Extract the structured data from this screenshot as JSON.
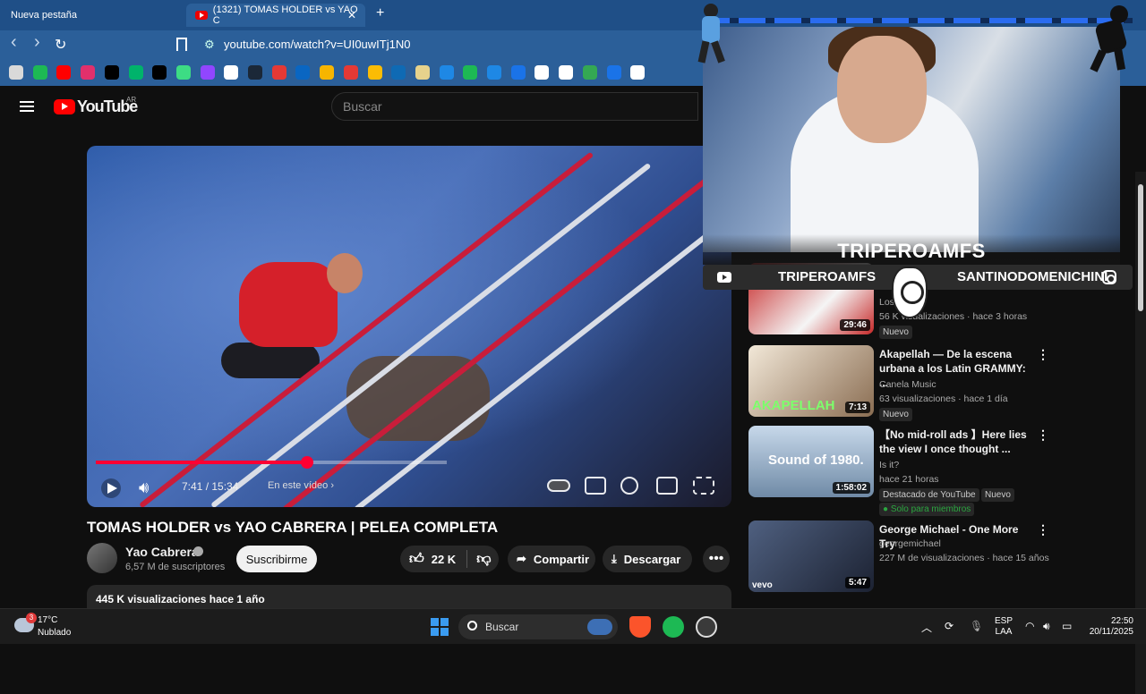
{
  "browser": {
    "tabs": [
      {
        "label": "Nueva pestaña"
      },
      {
        "label": "(1321) TOMAS HOLDER vs YAO C"
      }
    ],
    "close_glyph": "✕",
    "new_tab_glyph": "+",
    "url": "youtube.com/watch?v=UI0uwITj1N0",
    "nav": {
      "back": "‹",
      "forward": "›",
      "reload": "↻"
    },
    "bookmark_colors": [
      "#d9d9d9",
      "#1db954",
      "#ff0000",
      "#e1306c",
      "#000000",
      "#00b36b",
      "#000000",
      "#3ddc84",
      "#9146ff",
      "#ffffff",
      "#1b2838",
      "#e53935",
      "#0a66c2",
      "#f7b500",
      "#e53935",
      "#fbbc04",
      "#0f6ab4",
      "#e6d28c",
      "#1e88e5",
      "#1db954",
      "#1e88e5",
      "#1a73e8",
      "#ffffff",
      "#ffffff",
      "#34a853",
      "#1a73e8",
      "#ffffff"
    ]
  },
  "youtube": {
    "logo_text": "YouTube",
    "region": "AR",
    "search_placeholder": "Buscar"
  },
  "player": {
    "progress_fraction": 0.4885,
    "time": "7:41 / 15:34",
    "chapter": "En este vídeo  ›"
  },
  "video": {
    "title": "TOMAS HOLDER vs YAO CABRERA | PELEA COMPLETA",
    "channel": "Yao Cabrera",
    "subscribers": "6,57 M de suscriptores",
    "subscribe_label": "Suscribirme",
    "likes": "22 K",
    "share_label": "Compartir",
    "download_label": "Descargar",
    "more_glyph": "•••",
    "description_header": "445 K visualizaciones  hace 1 año"
  },
  "recommendations": [
    {
      "title": "",
      "channel": "Los Soberanos Hinchas",
      "channel_visible": "Los ... ntes",
      "meta": "56 K visualizaciones · hace 3 horas",
      "badge": "Nuevo",
      "duration": "29:46",
      "thumb_color": "#c62828"
    },
    {
      "title": "Akapellah — De la escena urbana a los Latin GRAMMY: ...",
      "channel": "Canela Music",
      "meta": "63 visualizaciones · hace 1 día",
      "badge": "Nuevo",
      "duration": "7:13",
      "thumb_color": "#6a5a4a",
      "thumb_text": "AKAPELLAH"
    },
    {
      "title": "【No mid-roll ads 】Here lies the view I once thought ...",
      "channel": "Is it?",
      "meta": "hace 21 horas",
      "badge": "Destacado de YouTube",
      "badge2": "Nuevo",
      "members": "Solo para miembros",
      "duration": "1:58:02",
      "thumb_color": "#8aa6c4",
      "thumb_text": "Sound of 1980."
    },
    {
      "title": "George Michael - One More Try",
      "channel": "georgemichael",
      "meta": "227 M de visualizaciones · hace 15 años",
      "duration": "5:47",
      "thumb_color": "#2b3a55",
      "thumb_text": "vevo"
    }
  ],
  "overlay": {
    "streamer_name": "TRIPEROAMFS",
    "youtube_handle": "TRIPEROAMFS",
    "instagram_handle": "SANTINODOMENICHINI"
  },
  "taskbar": {
    "weather_badge": "3",
    "temperature": "17°C",
    "condition": "Nublado",
    "search_label": "Buscar",
    "lang_top": "ESP",
    "lang_bottom": "LAA",
    "time": "22:50",
    "date": "20/11/2025"
  }
}
